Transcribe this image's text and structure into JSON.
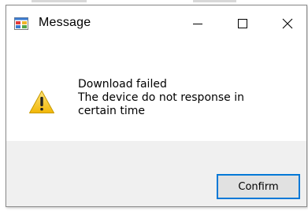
{
  "window": {
    "title": "Message",
    "app_icon": "form-app-icon",
    "controls": {
      "minimize_icon": "minimize-icon",
      "maximize_icon": "maximize-icon",
      "close_icon": "close-icon"
    }
  },
  "message": {
    "icon": "warning-icon",
    "lines": [
      "Download failed",
      "The device do not response in",
      "certain time"
    ]
  },
  "buttons": {
    "confirm_label": "Confirm"
  },
  "colors": {
    "accent": "#0078d7",
    "footer_bg": "#f0f0f0",
    "warning_yellow": "#f5c518"
  }
}
